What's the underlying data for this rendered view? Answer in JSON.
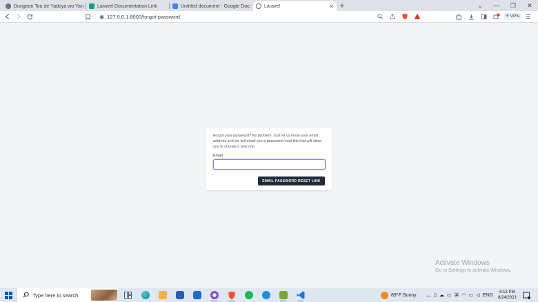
{
  "browser": {
    "tabs": [
      {
        "title": "Dungeon Tou de Yadoya wo Yarou! Sa",
        "favicon_color": "#6b7280"
      },
      {
        "title": "Laravel Documentation Link",
        "favicon_color": "#10a37f"
      },
      {
        "title": "Untitled document - Google Docs",
        "favicon_color": "#4285f4"
      },
      {
        "title": "Laravel",
        "favicon_color": "#9aa0a6",
        "active": true
      }
    ],
    "url": "127.0.0.1:8000/forgot-password",
    "vpn_label": "VPN"
  },
  "form": {
    "message": "Forgot your password? No problem. Just let us know your email address and we will email you a password reset link that will allow you to choose a new one.",
    "email_label": "Email",
    "email_value": "",
    "submit_label": "EMAIL PASSWORD RESET LINK"
  },
  "watermark": {
    "title": "Activate Windows",
    "subtitle": "Go to Settings to activate Windows."
  },
  "taskbar": {
    "search_placeholder": "Type here to search",
    "weather": "89°F  Sunny",
    "language": "ENG",
    "time": "6:13 PM",
    "date": "8/24/2023",
    "apps": [
      {
        "name": "task-view-icon",
        "color": "#3b4a5e"
      },
      {
        "name": "edge-icon",
        "color": "#0f7cd0"
      },
      {
        "name": "file-explorer-icon",
        "color": "#f2b632"
      },
      {
        "name": "store-icon",
        "color": "#2a5db0"
      },
      {
        "name": "mail-icon",
        "color": "#1a6fc4"
      },
      {
        "name": "copilot-icon",
        "color": "#7b52c6"
      },
      {
        "name": "brave-icon",
        "color": "#fb542b"
      },
      {
        "name": "spotify-icon",
        "color": "#1db954"
      },
      {
        "name": "edge-dev-icon",
        "color": "#1f8fd6"
      },
      {
        "name": "notepad-plus-icon",
        "color": "#7aa72f"
      },
      {
        "name": "vscode-icon",
        "color": "#1f7ad4"
      }
    ]
  }
}
